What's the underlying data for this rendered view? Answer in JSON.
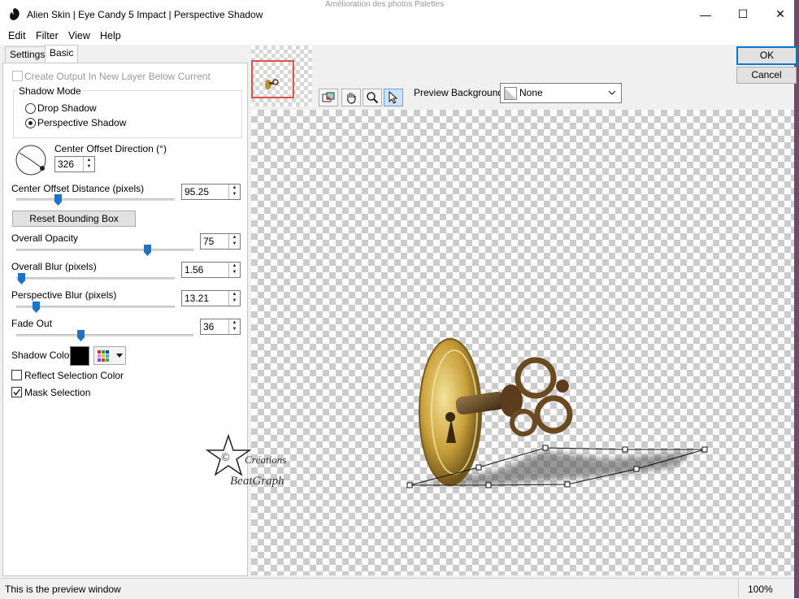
{
  "window": {
    "title": "Alien Skin | Eye Candy 5 Impact | Perspective Shadow",
    "minimize_glyph": "—",
    "maximize_glyph": "☐",
    "close_glyph": "✕"
  },
  "background_app_text": "Amélioration des photos    Palettes",
  "menu": [
    "Edit",
    "Filter",
    "View",
    "Help"
  ],
  "tabs": [
    "Settings",
    "Basic"
  ],
  "basic": {
    "create_output_label": "Create Output In New Layer Below Current",
    "create_output_checked": false,
    "shadow_mode": {
      "title": "Shadow Mode",
      "options": [
        "Drop Shadow",
        "Perspective Shadow"
      ],
      "selected": "Perspective Shadow"
    },
    "center_offset_direction": {
      "label": "Center Offset Direction (°)",
      "value": "326"
    },
    "center_offset_distance": {
      "label": "Center Offset Distance (pixels)",
      "value": "95.25"
    },
    "reset_button": "Reset Bounding Box",
    "overall_opacity": {
      "label": "Overall Opacity",
      "value": "75"
    },
    "overall_blur": {
      "label": "Overall Blur (pixels)",
      "value": "1.56"
    },
    "perspective_blur": {
      "label": "Perspective Blur (pixels)",
      "value": "13.21"
    },
    "fade_out": {
      "label": "Fade Out",
      "value": "36"
    },
    "shadow_color": {
      "label": "Shadow Color",
      "value": "#000000"
    },
    "reflect_selection_color": {
      "label": "Reflect Selection Color",
      "checked": false
    },
    "mask_selection": {
      "label": "Mask Selection",
      "checked": true
    }
  },
  "buttons": {
    "ok": "OK",
    "cancel": "Cancel"
  },
  "preview_background": {
    "label": "Preview Background:",
    "value": "None"
  },
  "toolbar_icons": [
    "navigator-icon",
    "hand-icon",
    "zoom-icon",
    "arrow-icon"
  ],
  "watermark": {
    "line1": "Créations",
    "line2": "BeatGraph"
  },
  "status": {
    "text": "This is the preview window",
    "zoom": "100%"
  }
}
